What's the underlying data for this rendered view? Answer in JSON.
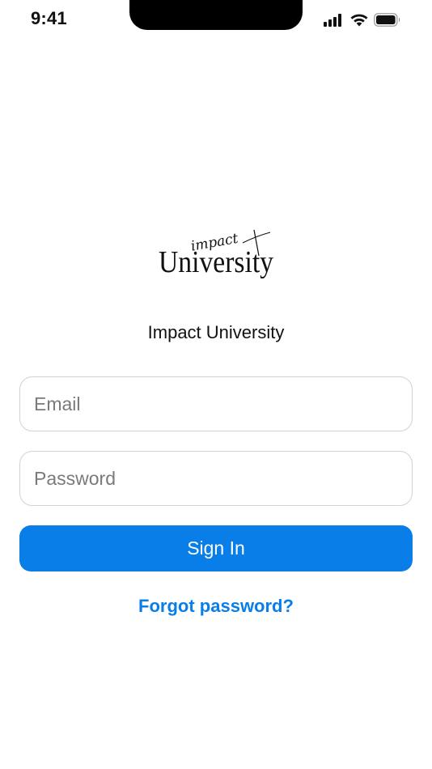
{
  "status_bar": {
    "time": "9:41",
    "icons": [
      "signal-icon",
      "wifi-icon",
      "battery-icon"
    ]
  },
  "logo": {
    "script_text": "impact",
    "serif_text": "University"
  },
  "brand": {
    "title": "Impact University"
  },
  "form": {
    "email_placeholder": "Email",
    "email_value": "",
    "password_placeholder": "Password",
    "password_value": "",
    "sign_in_label": "Sign In",
    "forgot_password_label": "Forgot password?"
  },
  "colors": {
    "accent": "#0a7ee8",
    "field_border": "#d2d2d2",
    "placeholder": "#7a7a7a",
    "text": "#111111"
  }
}
